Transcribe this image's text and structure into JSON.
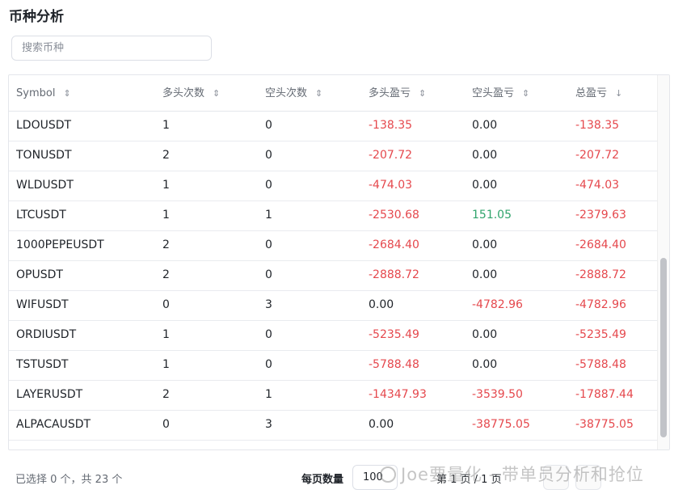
{
  "page": {
    "title": "币种分析"
  },
  "search": {
    "placeholder": "搜索币种"
  },
  "table": {
    "headers": [
      {
        "label": "Symbol",
        "sort": "⇕"
      },
      {
        "label": "多头次数",
        "sort": "⇕"
      },
      {
        "label": "空头次数",
        "sort": "⇕"
      },
      {
        "label": "多头盈亏",
        "sort": "⇕"
      },
      {
        "label": "空头盈亏",
        "sort": "⇕"
      },
      {
        "label": "总盈亏",
        "sort": "↓"
      }
    ],
    "rows": [
      [
        "LDOUSDT",
        "1",
        "0",
        "-138.35",
        "0.00",
        "-138.35"
      ],
      [
        "TONUSDT",
        "2",
        "0",
        "-207.72",
        "0.00",
        "-207.72"
      ],
      [
        "WLDUSDT",
        "1",
        "0",
        "-474.03",
        "0.00",
        "-474.03"
      ],
      [
        "LTCUSDT",
        "1",
        "1",
        "-2530.68",
        "151.05",
        "-2379.63"
      ],
      [
        "1000PEPEUSDT",
        "2",
        "0",
        "-2684.40",
        "0.00",
        "-2684.40"
      ],
      [
        "OPUSDT",
        "2",
        "0",
        "-2888.72",
        "0.00",
        "-2888.72"
      ],
      [
        "WIFUSDT",
        "0",
        "3",
        "0.00",
        "-4782.96",
        "-4782.96"
      ],
      [
        "ORDIUSDT",
        "1",
        "0",
        "-5235.49",
        "0.00",
        "-5235.49"
      ],
      [
        "TSTUSDT",
        "1",
        "0",
        "-5788.48",
        "0.00",
        "-5788.48"
      ],
      [
        "LAYERUSDT",
        "2",
        "1",
        "-14347.93",
        "-3539.50",
        "-17887.44"
      ],
      [
        "ALPACAUSDT",
        "0",
        "3",
        "0.00",
        "-38775.05",
        "-38775.05"
      ]
    ]
  },
  "colors": {
    "negative": "#e5484d",
    "positive": "#30a46c"
  },
  "footer": {
    "selected_text": "已选择 0 个，共 23 个",
    "per_page_label": "每页数量",
    "per_page_value": "100",
    "pager_text": "第 1 页 / 1 页"
  },
  "watermark": {
    "text": "Joe要量化 - 带单员分析和抢位"
  }
}
